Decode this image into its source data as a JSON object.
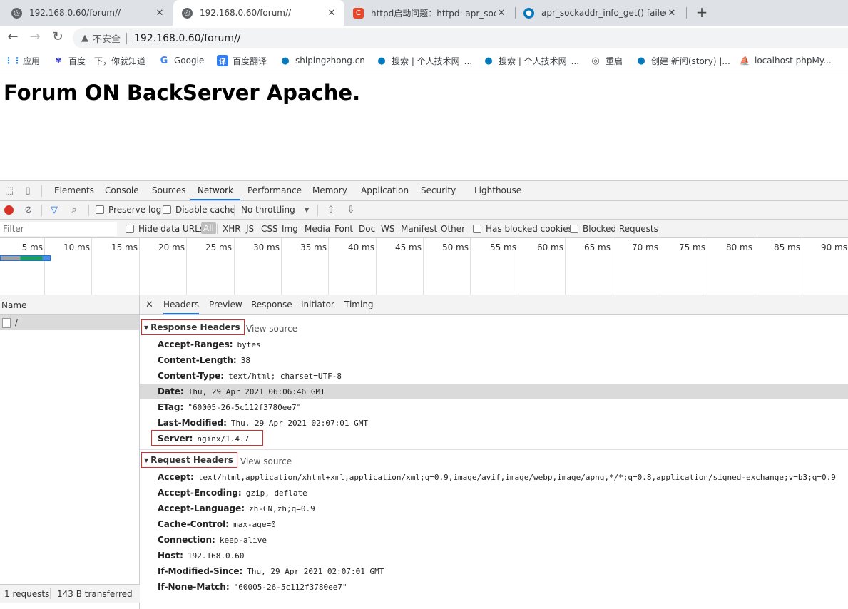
{
  "browser": {
    "tabs": [
      {
        "title": "192.168.0.60/forum//",
        "favicon": "globe-icon"
      },
      {
        "title": "192.168.0.60/forum//",
        "favicon": "globe-icon"
      },
      {
        "title": "httpd启动问题：httpd: apr_soc",
        "favicon": "csdn-icon"
      },
      {
        "title": "apr_sockaddr_info_get() failed",
        "favicon": "drupal-icon"
      }
    ],
    "new_tab": "+",
    "tab_close": "✕",
    "security_label": "不安全",
    "url": "192.168.0.60/forum//",
    "bookmarks": [
      {
        "label": "应用"
      },
      {
        "label": "百度一下，你就知道"
      },
      {
        "label": "Google"
      },
      {
        "label": "百度翻译"
      },
      {
        "label": "shipingzhong.cn"
      },
      {
        "label": "搜索 | 个人技术网_..."
      },
      {
        "label": "搜索 | 个人技术网_..."
      },
      {
        "label": "重启"
      },
      {
        "label": "创建 新闻(story) |..."
      },
      {
        "label": "localhost phpMy..."
      }
    ]
  },
  "page": {
    "heading": "Forum ON BackServer Apache."
  },
  "devtools": {
    "panels": [
      "Elements",
      "Console",
      "Sources",
      "Network",
      "Performance",
      "Memory",
      "Application",
      "Security",
      "Lighthouse"
    ],
    "active_panel": "Network",
    "toolbar": {
      "preserve_log": "Preserve log",
      "disable_cache": "Disable cache",
      "throttling": "No throttling"
    },
    "filter": {
      "placeholder": "Filter",
      "hide_data_urls": "Hide data URLs",
      "types": [
        "All",
        "XHR",
        "JS",
        "CSS",
        "Img",
        "Media",
        "Font",
        "Doc",
        "WS",
        "Manifest",
        "Other"
      ],
      "has_blocked_cookies": "Has blocked cookies",
      "blocked_requests": "Blocked Requests"
    },
    "timeline_ticks": [
      "5 ms",
      "10 ms",
      "15 ms",
      "20 ms",
      "25 ms",
      "30 ms",
      "35 ms",
      "40 ms",
      "45 ms",
      "50 ms",
      "55 ms",
      "60 ms",
      "65 ms",
      "70 ms",
      "75 ms",
      "80 ms",
      "85 ms",
      "90 ms"
    ],
    "name_column": "Name",
    "requests": [
      {
        "name": "/"
      }
    ],
    "status": {
      "requests": "1 requests",
      "transferred": "143 B transferred"
    },
    "detail_tabs": [
      "Headers",
      "Preview",
      "Response",
      "Initiator",
      "Timing"
    ],
    "active_detail_tab": "Headers",
    "response_headers": {
      "title": "Response Headers",
      "view_source": "View source",
      "items": [
        {
          "key": "Accept-Ranges:",
          "value": "bytes"
        },
        {
          "key": "Content-Length:",
          "value": "38"
        },
        {
          "key": "Content-Type:",
          "value": "text/html; charset=UTF-8"
        },
        {
          "key": "Date:",
          "value": "Thu, 29 Apr 2021 06:06:46 GMT"
        },
        {
          "key": "ETag:",
          "value": "\"60005-26-5c112f3780ee7\""
        },
        {
          "key": "Last-Modified:",
          "value": "Thu, 29 Apr 2021 02:07:01 GMT"
        },
        {
          "key": "Server:",
          "value": "nginx/1.4.7"
        }
      ]
    },
    "request_headers": {
      "title": "Request Headers",
      "view_source": "View source",
      "items": [
        {
          "key": "Accept:",
          "value": "text/html,application/xhtml+xml,application/xml;q=0.9,image/avif,image/webp,image/apng,*/*;q=0.8,application/signed-exchange;v=b3;q=0.9"
        },
        {
          "key": "Accept-Encoding:",
          "value": "gzip, deflate"
        },
        {
          "key": "Accept-Language:",
          "value": "zh-CN,zh;q=0.9"
        },
        {
          "key": "Cache-Control:",
          "value": "max-age=0"
        },
        {
          "key": "Connection:",
          "value": "keep-alive"
        },
        {
          "key": "Host:",
          "value": "192.168.0.60"
        },
        {
          "key": "If-Modified-Since:",
          "value": "Thu, 29 Apr 2021 02:07:01 GMT"
        },
        {
          "key": "If-None-Match:",
          "value": "\"60005-26-5c112f3780ee7\""
        }
      ]
    }
  }
}
